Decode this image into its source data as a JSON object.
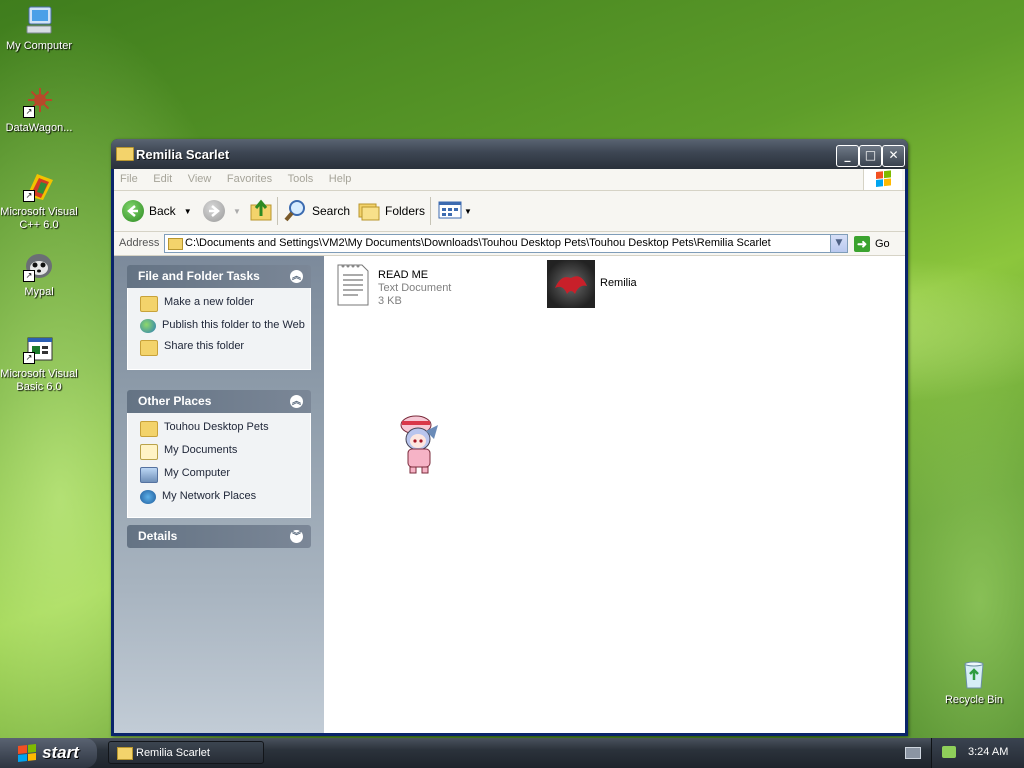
{
  "desktop": {
    "icons": [
      {
        "label": "My Computer",
        "icon": "my-computer-icon"
      },
      {
        "label": "DataWagon...",
        "icon": "datawagon-shortcut-icon"
      },
      {
        "label": "Microsoft Visual C++ 6.0",
        "icon": "visual-cpp-shortcut-icon"
      },
      {
        "label": "Mypal",
        "icon": "mypal-shortcut-icon"
      },
      {
        "label": "Microsoft Visual Basic 6.0",
        "icon": "visual-basic-shortcut-icon"
      },
      {
        "label": "Recycle Bin",
        "icon": "recycle-bin-icon"
      }
    ]
  },
  "window": {
    "title": "Remilia Scarlet",
    "menu": [
      "File",
      "Edit",
      "View",
      "Favorites",
      "Tools",
      "Help"
    ],
    "toolbar": {
      "back_label": "Back",
      "search_label": "Search",
      "folders_label": "Folders"
    },
    "address": {
      "label": "Address",
      "path": "C:\\Documents and Settings\\VM2\\My Documents\\Downloads\\Touhou Desktop Pets\\Touhou Desktop Pets\\Remilia Scarlet",
      "go_label": "Go"
    },
    "taskpane": {
      "file_folder_tasks": {
        "title": "File and Folder Tasks",
        "items": [
          "Make a new folder",
          "Publish this folder to the Web",
          "Share this folder"
        ]
      },
      "other_places": {
        "title": "Other Places",
        "items": [
          "Touhou Desktop Pets",
          "My Documents",
          "My Computer",
          "My Network Places"
        ]
      },
      "details": {
        "title": "Details"
      }
    },
    "files": [
      {
        "name": "READ ME",
        "type": "Text Document",
        "size": "3 KB",
        "icon": "text-document-icon"
      },
      {
        "name": "Remilia",
        "icon": "remilia-application-icon"
      }
    ]
  },
  "taskbar": {
    "start_label": "start",
    "open_windows": [
      "Remilia Scarlet"
    ],
    "clock": "3:24 AM"
  }
}
